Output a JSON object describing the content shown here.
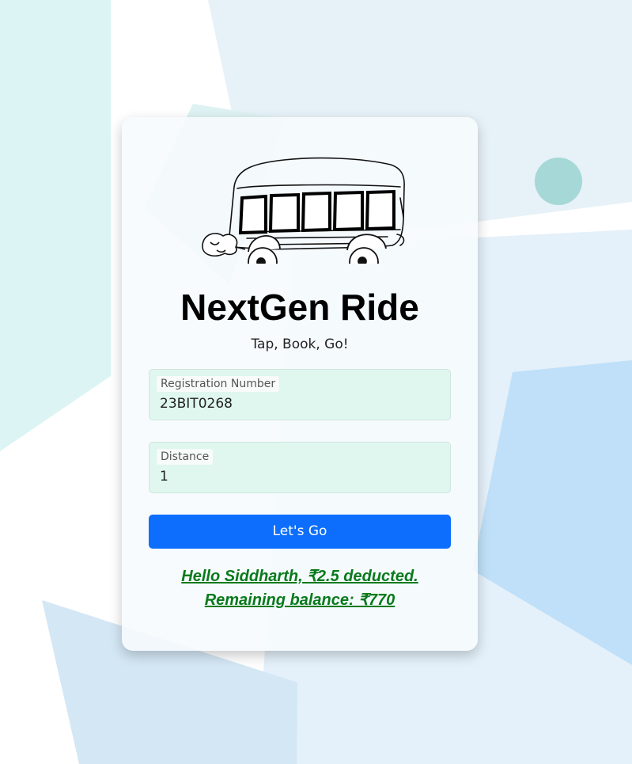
{
  "colors": {
    "accent": "#0d6efd",
    "success": "#087a1c",
    "field_bg": "#dff7ef"
  },
  "app": {
    "logo_icon": "bus-icon",
    "title": "NextGen Ride",
    "subtitle": "Tap, Book, Go!"
  },
  "form": {
    "registration": {
      "label": "Registration Number",
      "value": "23BIT0268"
    },
    "distance": {
      "label": "Distance",
      "value": "1"
    },
    "submit_label": "Let's Go"
  },
  "result": {
    "line1": "Hello Siddharth, ₹2.5 deducted.",
    "line2": "Remaining balance: ₹770"
  }
}
